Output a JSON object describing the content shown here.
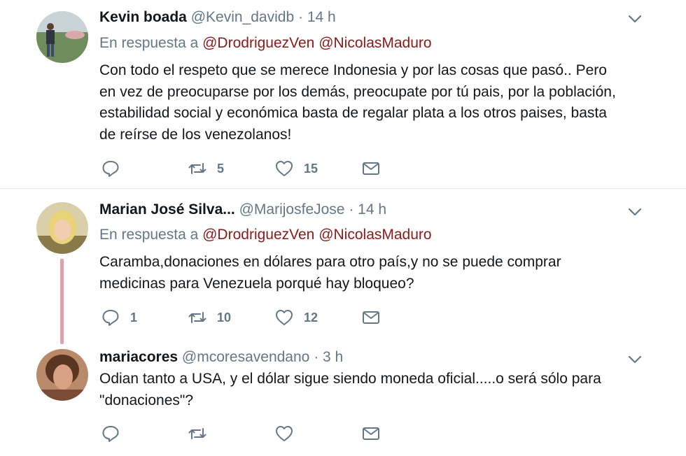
{
  "tweets": [
    {
      "name": "Kevin boada",
      "handle": "@Kevin_davidb",
      "time": "14 h",
      "reply_prefix": "En respuesta a",
      "mentions": [
        "@DrodriguezVen",
        "@NicolasMaduro"
      ],
      "text_lines": [
        "Con todo el respeto que se merece Indonesia y por las cosas que pasó.. Pero",
        "en vez de preocuparse por los demás, preocupate por tú pais, por la población,",
        "estabilidad social y económica basta de regalar plata a los otros paises, basta",
        "de reírse de los venezolanos!"
      ],
      "replies": "",
      "retweets": "5",
      "likes": "15"
    },
    {
      "name": "Marian José Silva...",
      "handle": "@MarijosfeJose",
      "time": "14 h",
      "reply_prefix": "En respuesta a",
      "mentions": [
        "@DrodriguezVen",
        "@NicolasMaduro"
      ],
      "text_lines": [
        "Caramba,donaciones en dólares para otro país,y no se puede comprar",
        "medicinas para Venezuela porqué hay bloqueo?"
      ],
      "replies": "1",
      "retweets": "10",
      "likes": "12"
    },
    {
      "name": "mariacores",
      "handle": "@mcoresavendano",
      "time": "3 h",
      "text_lines": [
        "Odian tanto a USA, y el dólar sigue siendo moneda oficial.....o será sólo para",
        "\"donaciones\"?"
      ],
      "replies": "",
      "retweets": "",
      "likes": ""
    }
  ],
  "separator": "·",
  "colors": {
    "mention": "#8b1a1a",
    "muted": "#657786",
    "thread_line": "#dba3ad"
  },
  "icons": [
    "reply-icon",
    "retweet-icon",
    "like-icon",
    "direct-message-icon",
    "chevron-down-icon"
  ]
}
